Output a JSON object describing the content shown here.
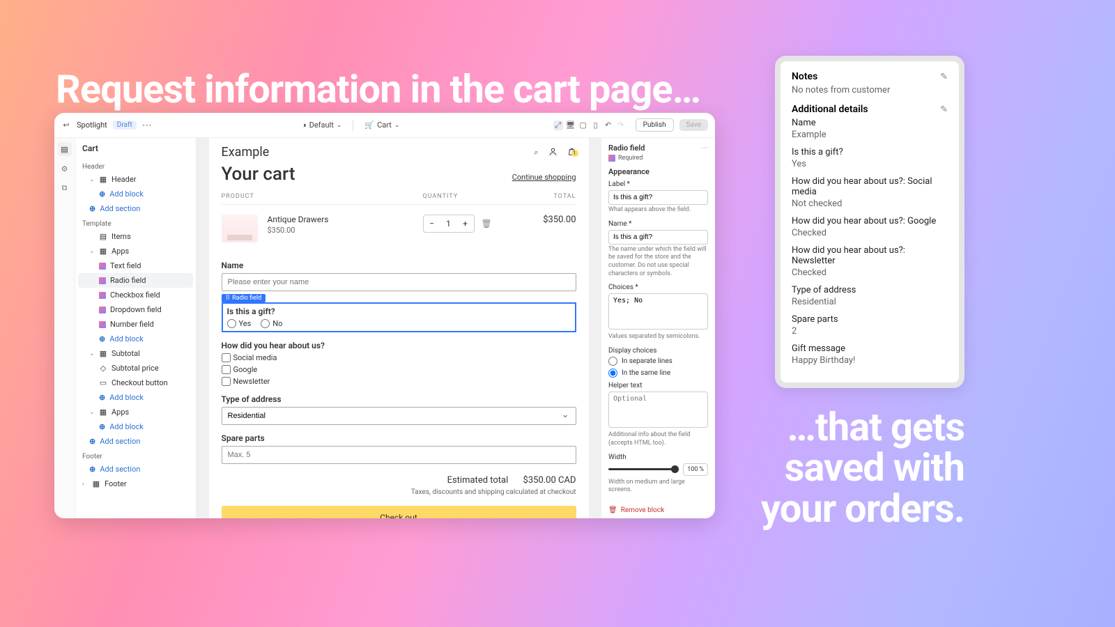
{
  "headline_top": "Request information in the cart page…",
  "headline_bottom": "…that gets\nsaved with\nyour orders.",
  "topbar": {
    "theme_name": "Spotlight",
    "draft": "Draft",
    "default_label": "Default",
    "cart_label": "Cart",
    "publish": "Publish",
    "save": "Save"
  },
  "sidebar": {
    "title": "Cart",
    "header_sub": "Header",
    "header_item": "Header",
    "add_block": "Add block",
    "add_section": "Add section",
    "template_sub": "Template",
    "items": "Items",
    "apps": "Apps",
    "text_field": "Text field",
    "radio_field": "Radio field",
    "checkbox_field": "Checkbox field",
    "dropdown_field": "Dropdown field",
    "number_field": "Number field",
    "subtotal": "Subtotal",
    "subtotal_price": "Subtotal price",
    "checkout_button": "Checkout button",
    "footer_sub": "Footer",
    "footer": "Footer"
  },
  "preview": {
    "example": "Example",
    "your_cart": "Your cart",
    "continue": "Continue shopping",
    "col_product": "PRODUCT",
    "col_qty": "QUANTITY",
    "col_total": "TOTAL",
    "prod_name": "Antique Drawers",
    "prod_price": "$350.00",
    "qty": "1",
    "line_total": "$350.00",
    "name_label": "Name",
    "name_placeholder": "Please enter your name",
    "radio_tag": "Radio field",
    "gift_label": "Is this a gift?",
    "yes": "Yes",
    "no": "No",
    "hear_label": "How did you hear about us?",
    "hear_1": "Social media",
    "hear_2": "Google",
    "hear_3": "Newsletter",
    "addr_label": "Type of address",
    "addr_value": "Residential",
    "spare_label": "Spare parts",
    "spare_placeholder": "Max. 5",
    "est_label": "Estimated total",
    "est_value": "$350.00 CAD",
    "tax_note": "Taxes, discounts and shipping calculated at checkout",
    "checkout": "Check out",
    "bag_count": "1"
  },
  "inspector": {
    "title": "Radio field",
    "required": "Required",
    "appearance": "Appearance",
    "label_lbl": "Label *",
    "label_val": "Is this a gift?",
    "label_hint": "What appears above the field.",
    "name_lbl": "Name *",
    "name_val": "Is this a gift?",
    "name_hint": "The name under which the field will be saved for the store and the customer. Do not use special characters or symbols.",
    "choices_lbl": "Choices *",
    "choices_val": "Yes; No",
    "choices_hint": "Values separated by semicolons.",
    "display_lbl": "Display choices",
    "disp_sep": "In separate lines",
    "disp_same": "In the same line",
    "helper_lbl": "Helper text",
    "helper_placeholder": "Optional",
    "helper_hint": "Additional info about the field (accepts HTML too).",
    "width_lbl": "Width",
    "width_val": "100",
    "width_unit": "%",
    "width_hint": "Width on medium and large screens.",
    "remove": "Remove block"
  },
  "notes": {
    "notes_t": "Notes",
    "no_notes": "No notes from customer",
    "add_t": "Additional details",
    "items": [
      {
        "k": "Name",
        "v": "Example"
      },
      {
        "k": "Is this a gift?",
        "v": "Yes"
      },
      {
        "k": "How did you hear about us?: Social media",
        "v": "Not checked"
      },
      {
        "k": "How did you hear about us?: Google",
        "v": "Checked"
      },
      {
        "k": "How did you hear about us?: Newsletter",
        "v": "Checked"
      },
      {
        "k": "Type of address",
        "v": "Residential"
      },
      {
        "k": "Spare parts",
        "v": "2"
      },
      {
        "k": "Gift message",
        "v": "Happy Birthday!"
      }
    ]
  }
}
